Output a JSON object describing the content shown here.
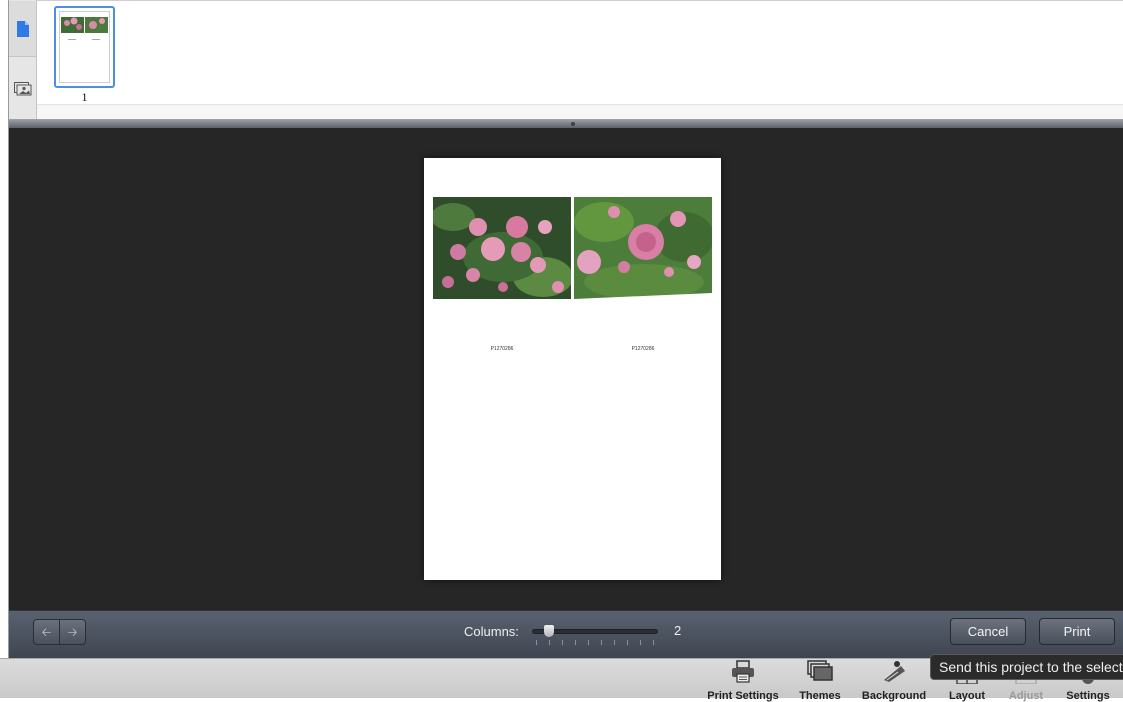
{
  "browser": {
    "thumbnails": [
      {
        "label": "1"
      }
    ]
  },
  "preview": {
    "photos": [
      {
        "caption": "P1270286"
      },
      {
        "caption": "P1270286"
      }
    ]
  },
  "toolbar": {
    "columns_label": "Columns:",
    "columns_value": "2",
    "columns_min": 1,
    "columns_max": 10,
    "cancel_label": "Cancel",
    "print_label": "Print"
  },
  "app_bar": {
    "items": [
      {
        "label": "Print Settings",
        "icon": "printer-icon"
      },
      {
        "label": "Themes",
        "icon": "themes-icon"
      },
      {
        "label": "Background",
        "icon": "background-icon"
      },
      {
        "label": "Layout",
        "icon": "layout-icon"
      },
      {
        "label": "Adjust",
        "icon": "adjust-icon",
        "disabled": true
      },
      {
        "label": "Settings",
        "icon": "settings-gear-icon"
      }
    ]
  },
  "tooltip": {
    "text": "Send this project to the selecte"
  },
  "colors": {
    "selection": "#4a8fe0",
    "preview_bg": "#262626",
    "toolbar": "#4d5460"
  }
}
